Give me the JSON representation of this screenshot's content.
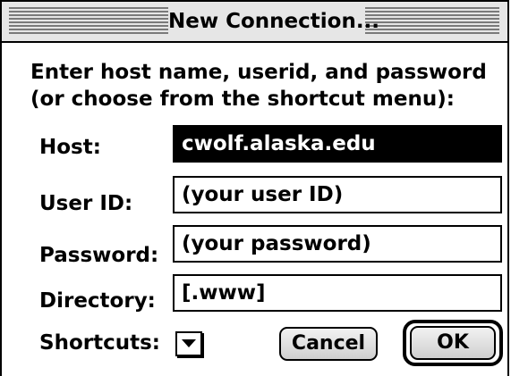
{
  "window": {
    "title": "New Connection..."
  },
  "prompt": {
    "text": "Enter host name, userid, and password (or choose from the shortcut menu):"
  },
  "fields": {
    "host_label": "Host:",
    "host_value": "cwolf.alaska.edu",
    "userid_label": "User ID:",
    "userid_value": "(your user ID)",
    "password_label": "Password:",
    "password_value": "(your password)",
    "directory_label": "Directory:",
    "directory_value": "[.www]",
    "shortcuts_label": "Shortcuts:"
  },
  "buttons": {
    "cancel_label": "Cancel",
    "ok_label": "OK"
  },
  "icons": {
    "shortcuts_popup": "triangle-down-icon"
  },
  "colors": {
    "titlebar": "#e6e6e6",
    "selection": "#000000"
  }
}
